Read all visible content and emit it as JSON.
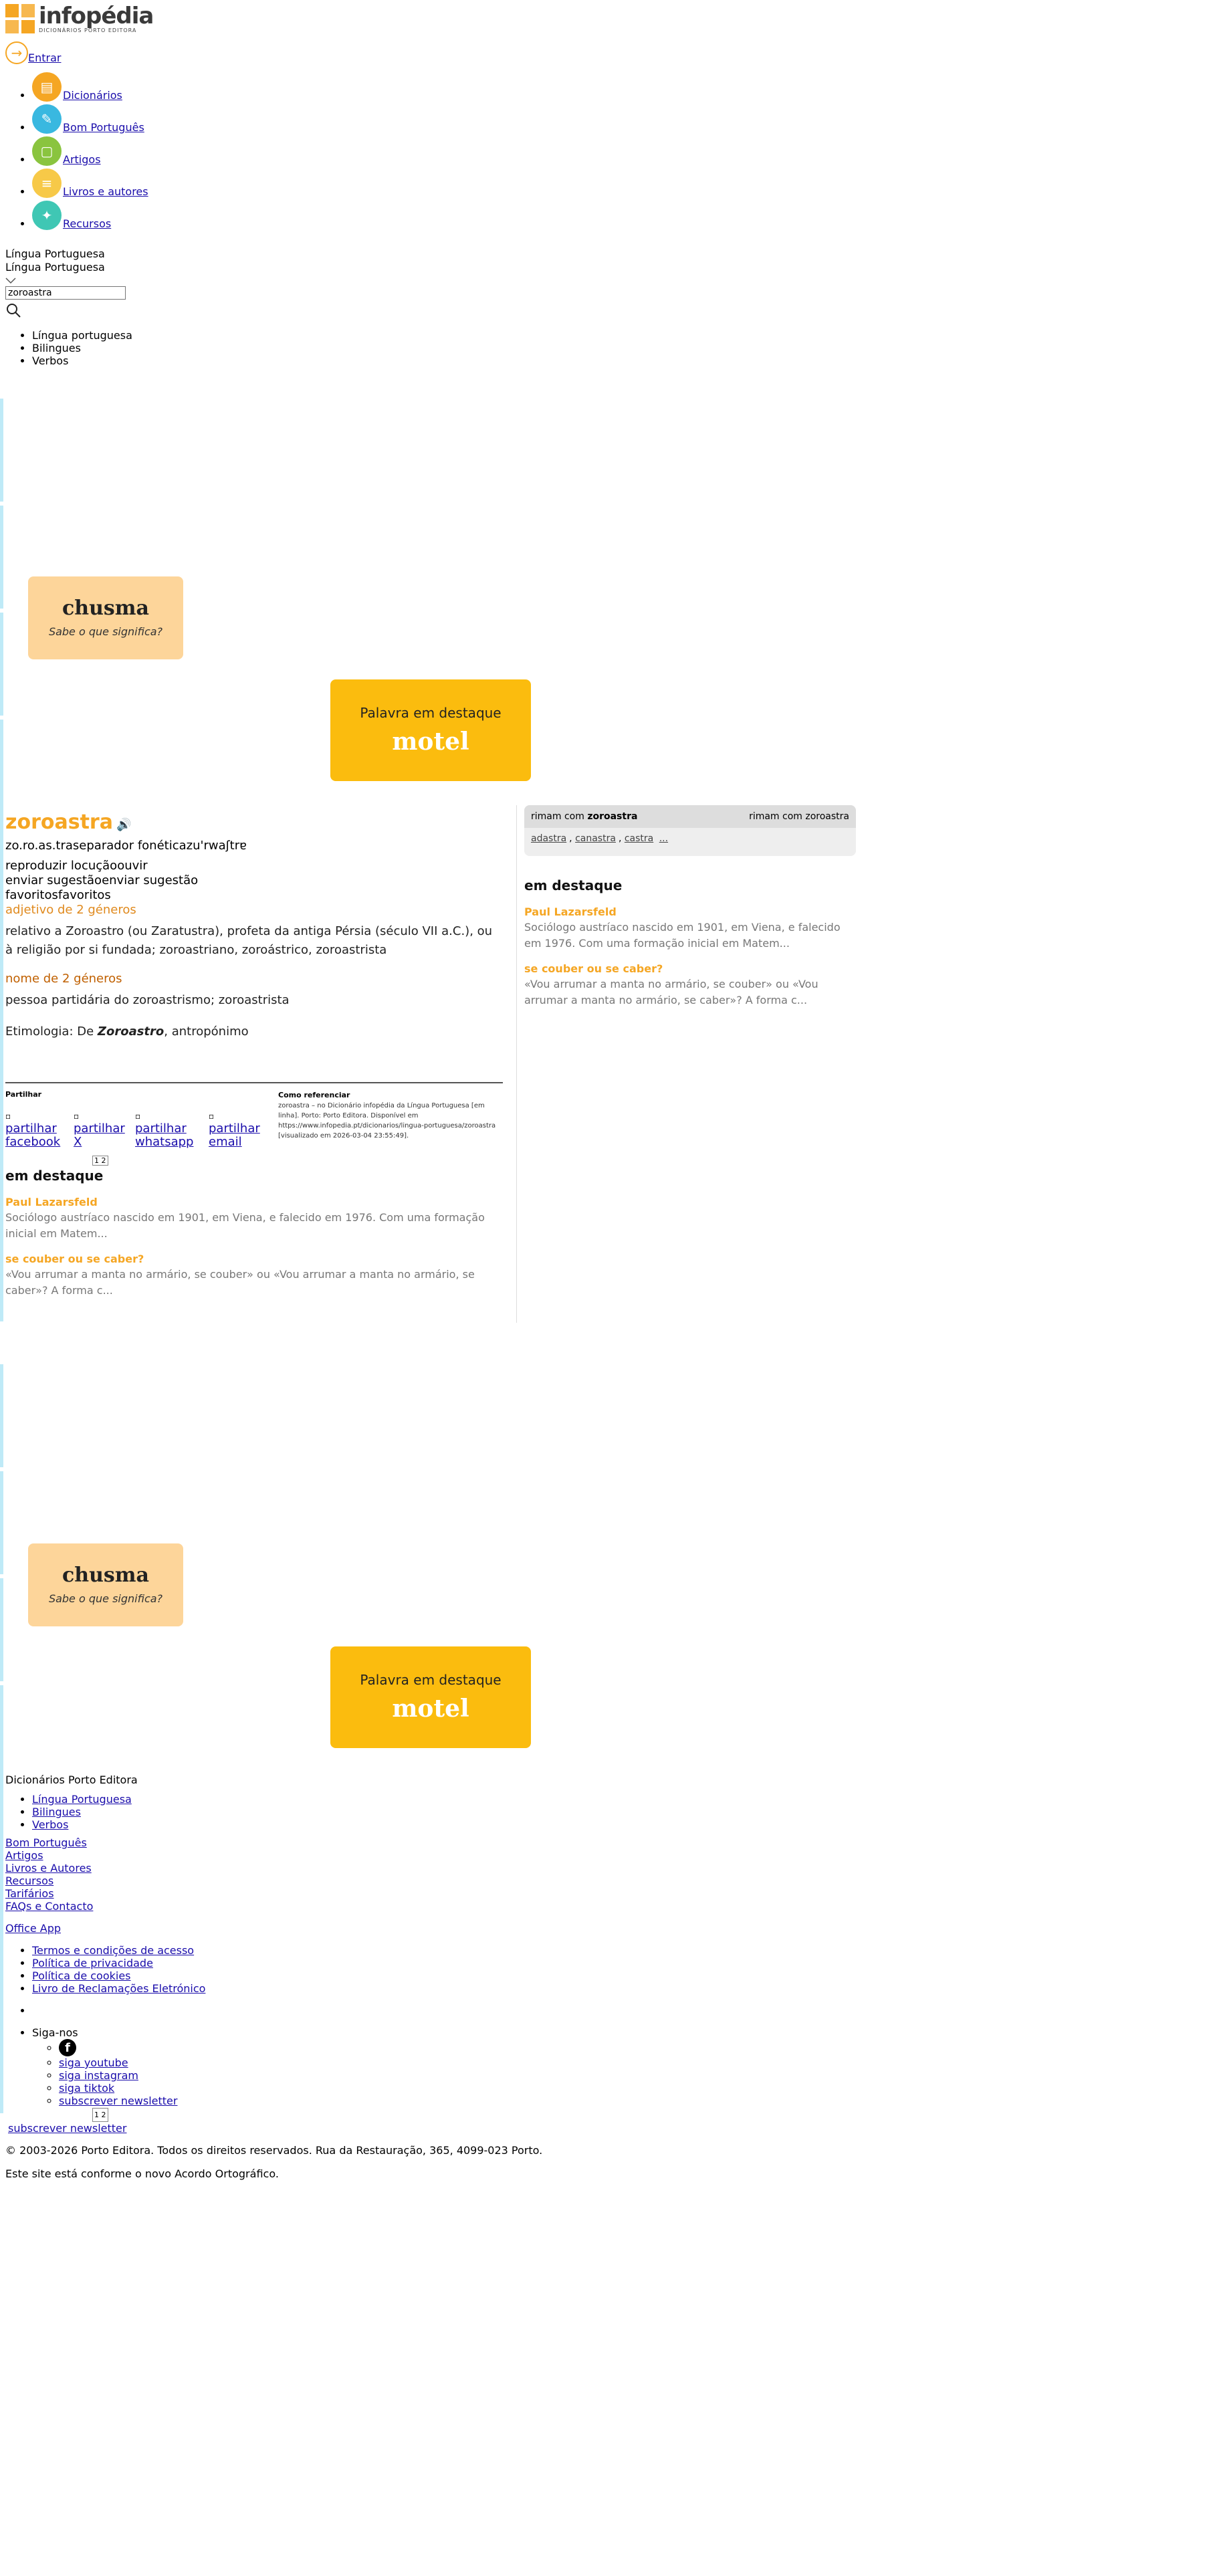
{
  "header": {
    "logo_title": "infopédia",
    "logo_subtitle": "DICIONÁRIOS PORTO EDITORA",
    "login_label": "Entrar",
    "nav": [
      {
        "label": "Dicionários",
        "icon": "book-icon",
        "color": "#f5a623"
      },
      {
        "label": "Bom Português",
        "icon": "pencil-icon",
        "color": "#39b8e0"
      },
      {
        "label": "Artigos",
        "icon": "document-icon",
        "color": "#8ac43f"
      },
      {
        "label": "Livros e autores",
        "icon": "books-icon",
        "color": "#f7c948"
      },
      {
        "label": "Recursos",
        "icon": "resources-icon",
        "color": "#3fc7b4"
      }
    ],
    "language_label": "Língua Portuguesa",
    "language_selected": "Língua Portuguesa",
    "search_value": "zoroastra",
    "search_options": [
      "Língua portuguesa",
      "Bilingues",
      "Verbos"
    ]
  },
  "promos": {
    "chusma_word": "chusma",
    "chusma_sub": "Sabe o que significa?",
    "motel_sub": "Palavra em destaque",
    "motel_word": "motel"
  },
  "entry": {
    "headword": "zoroastra",
    "syllables": "zo.ro.as.tra",
    "phon_sep_alt": "separador fonética",
    "phonetic": "zu'rwaʃtrɐ",
    "actions": [
      {
        "alt": "reproduzir locução",
        "label": "ouvir"
      },
      {
        "alt": "enviar sugestão",
        "label": "enviar sugestão"
      },
      {
        "alt": "favoritos",
        "label": "favoritos"
      }
    ],
    "sense1_gram": "adjetivo de 2 géneros",
    "sense1_def": "relativo a Zoroastro (ou Zaratustra), profeta da antiga Pérsia (século VII a.C.), ou à religião por si fundada; zoroastriano, zoroástrico, zoroastrista",
    "sense2_gram": "nome de 2 géneros",
    "sense2_def": "pessoa partidária do zoroastrismo; zoroastrista",
    "etym_label": "Etimologia: De ",
    "etym_word": "Zoroastro",
    "etym_rest": ", antropónimo"
  },
  "share": {
    "title": "Partilhar",
    "links": [
      "partilhar facebook",
      "partilhar X",
      "partilhar whatsapp",
      "partilhar email"
    ],
    "pager": "1 2"
  },
  "reference": {
    "title": "Como referenciar",
    "text": "zoroastra – no Dicionário infopédia da Língua Portuguesa [em linha]. Porto: Porto Editora. Disponível em https://www.infopedia.pt/dicionarios/lingua-portuguesa/zoroastra [visualizado em 2026-03-04 23:55:49]."
  },
  "destaque": {
    "heading": "em destaque",
    "items": [
      {
        "title": "Paul Lazarsfeld",
        "text": "Sociólogo austríaco nascido em 1901, em Viena, e falecido em 1976. Com uma formação inicial em Matem..."
      },
      {
        "title": "se couber ou se caber?",
        "text": "«Vou arrumar a manta no armário, se couber» ou «Vou arrumar a manta no armário, se caber»? A forma c..."
      }
    ]
  },
  "rhymes": {
    "label_pre": "rimam com ",
    "label_word": "zoroastra",
    "img_alt": "rimam com zoroastra",
    "words": [
      "adastra",
      "canastra",
      "castra",
      "..."
    ]
  },
  "footer": {
    "brand": "Dicionários Porto Editora",
    "dict_links": [
      "Língua Portuguesa",
      "Bilingues",
      "Verbos"
    ],
    "links": [
      "Bom Português",
      "Artigos",
      "Livros e Autores",
      "Recursos",
      "Tarifários",
      "FAQs e Contacto"
    ],
    "office_app": "Office App",
    "legal": [
      "Termos e condições de acesso",
      "Política de privacidade",
      "Política de cookies",
      "Livro de Reclamações Eletrónico"
    ],
    "follow": "Siga-nos",
    "social": [
      "siga youtube",
      "siga instagram",
      "siga tiktok",
      "subscrever newsletter"
    ],
    "pager": "1 2",
    "newsletter": "subscrever newsletter",
    "copyright": "© 2003-2026 Porto Editora. Todos os direitos reservados. Rua da Restauração, 365, 4099-023 Porto.",
    "ao_note": "Este site está conforme o novo Acordo Ortográfico."
  }
}
